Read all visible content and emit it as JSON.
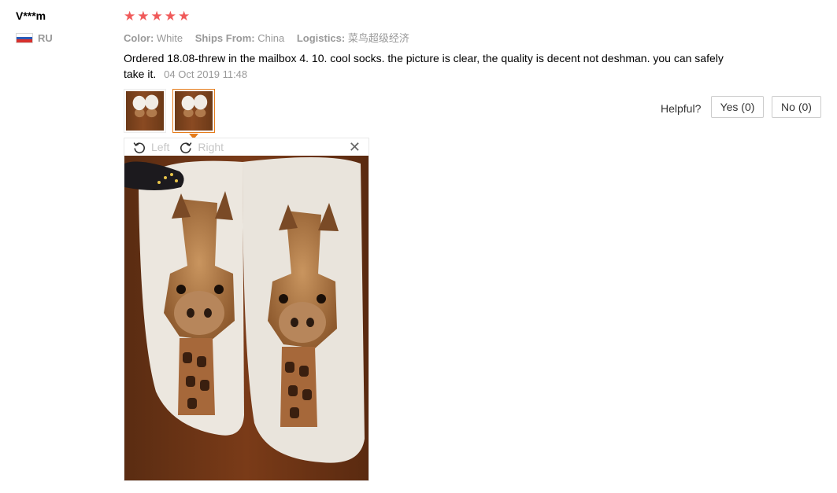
{
  "review": {
    "user": "V***m",
    "country_code": "RU",
    "flag_colors": [
      "#ffffff",
      "#2a5bb8",
      "#d8312d"
    ],
    "rating": 5,
    "stars": [
      "★",
      "★",
      "★",
      "★",
      "★"
    ],
    "star_color": "#f05a5a",
    "attributes": {
      "color_label": "Color:",
      "color_value": "White",
      "ships_label": "Ships From:",
      "ships_value": "China",
      "logistics_label": "Logistics:",
      "logistics_value": "菜鸟超级经济"
    },
    "text": "Ordered 18.08-threw in the mailbox 4. 10. cool socks. the picture is clear, the quality is decent not deshman. you can safely take it.",
    "date": "04 Oct 2019 11:48"
  },
  "thumbnails": [
    {
      "name": "photo-thumbnail-1",
      "active": false
    },
    {
      "name": "photo-thumbnail-2",
      "active": true
    }
  ],
  "viewer": {
    "rotate_left_label": "Left",
    "rotate_right_label": "Right",
    "close_icon": "✕",
    "image_subject": "giraffe-print-socks-photo"
  },
  "helpful": {
    "label": "Helpful?",
    "yes_label": "Yes (0)",
    "no_label": "No (0)"
  },
  "accent_color": "#e57c1b"
}
